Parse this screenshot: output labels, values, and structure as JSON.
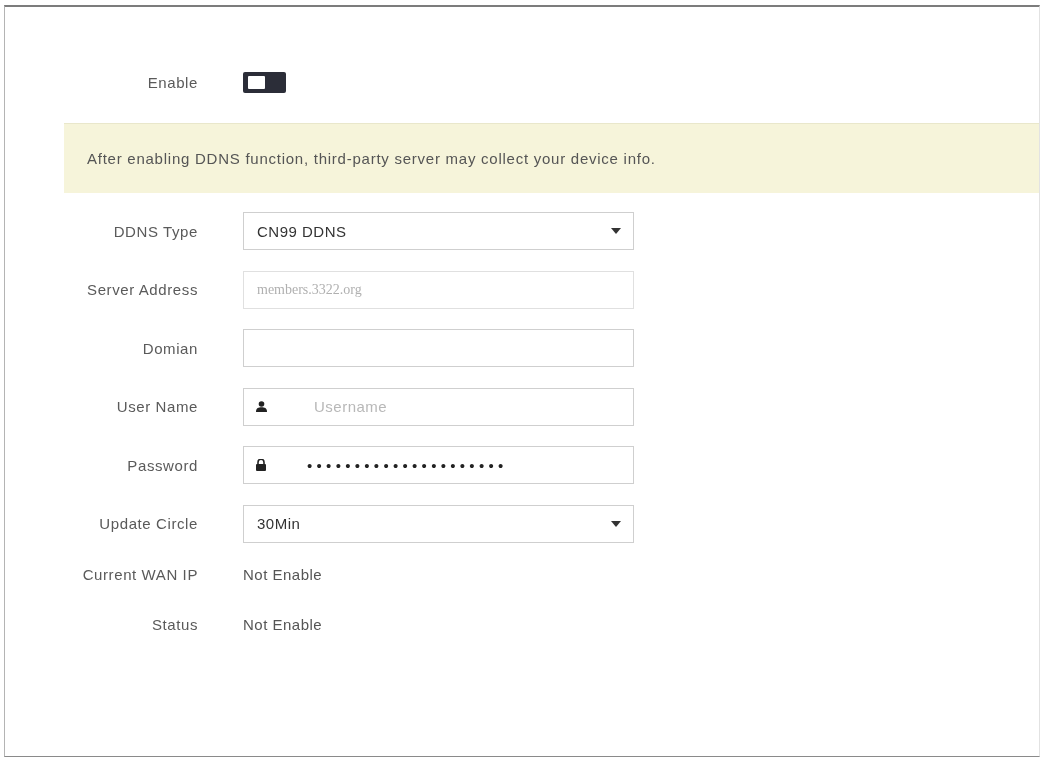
{
  "enable": {
    "label": "Enable",
    "on": false
  },
  "notice": {
    "text": "After enabling DDNS function, third-party server may collect your device info."
  },
  "fields": [
    {
      "kind": "select",
      "label": "DDNS Type",
      "value": "CN99 DDNS",
      "disabled": false
    },
    {
      "kind": "input",
      "label": "Server Address",
      "value": "members.3322.org",
      "disabled": true
    },
    {
      "kind": "input",
      "label": "Domian",
      "disabled": false
    },
    {
      "kind": "user",
      "label": "User Name",
      "placeholder": "Username",
      "disabled": false
    },
    {
      "kind": "password",
      "label": "Password",
      "value": "•••••••••••••••••••••",
      "disabled": false
    },
    {
      "kind": "select",
      "label": "Update Circle",
      "value": "30Min",
      "disabled": false
    }
  ],
  "info": [
    {
      "label": "Current WAN IP",
      "value": "Not Enable"
    },
    {
      "label": "Status",
      "value": "Not Enable"
    }
  ]
}
